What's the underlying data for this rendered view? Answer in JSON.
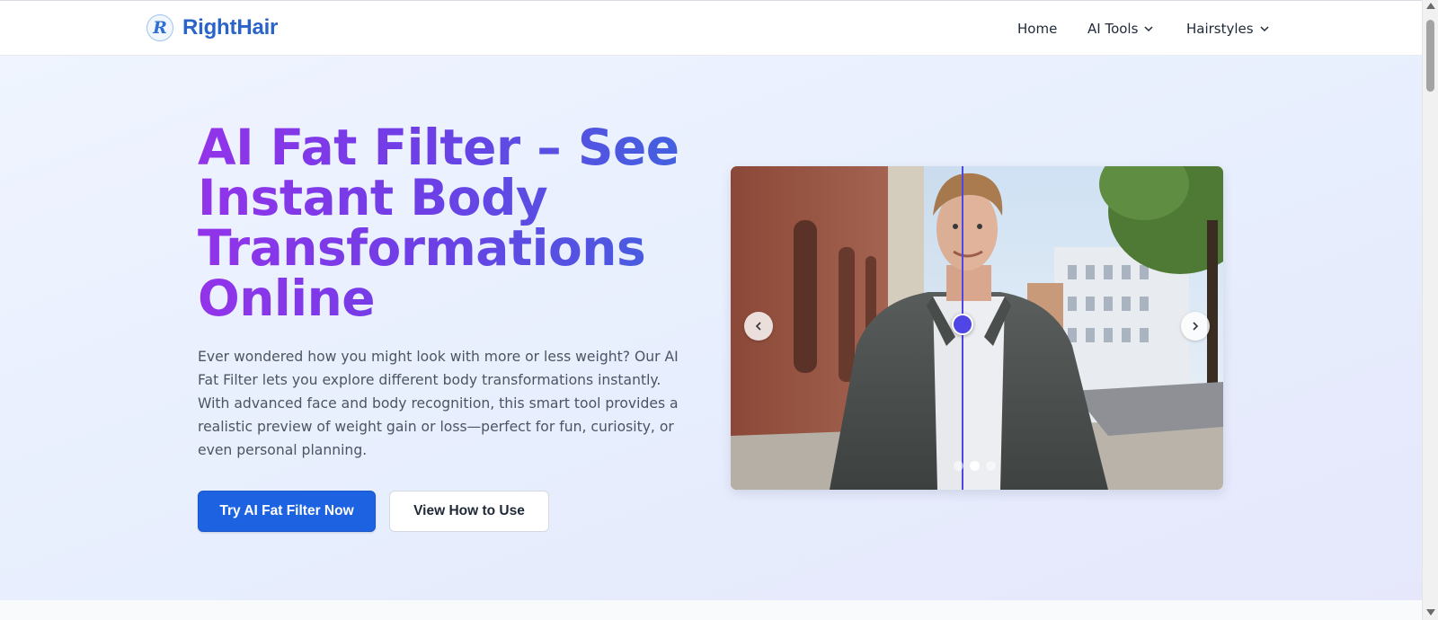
{
  "brand": {
    "logo_letter": "R",
    "name": "RightHair",
    "color": "#2a64c9"
  },
  "nav": {
    "home": "Home",
    "ai_tools": "AI Tools",
    "hairstyles": "Hairstyles"
  },
  "hero": {
    "title": "AI Fat Filter – See Instant Body Transformations Online",
    "description": "Ever wondered how you might look with more or less weight? Our AI Fat Filter lets you explore different body transformations instantly. With advanced face and body recognition, this smart tool provides a realistic preview of weight gain or loss—perfect for fun, curiosity, or even personal planning.",
    "primary_button": "Try AI Fat Filter Now",
    "secondary_button": "View How to Use",
    "title_gradient": [
      "#9333ea",
      "#3f63de"
    ],
    "primary_color": "#1d63e1"
  },
  "comparison": {
    "divider_position_fraction": 0.47,
    "slides": 3,
    "active_slide": 2,
    "accent": "#4f46e5",
    "prev_icon": "chevron-left-icon",
    "next_icon": "chevron-right-icon"
  }
}
